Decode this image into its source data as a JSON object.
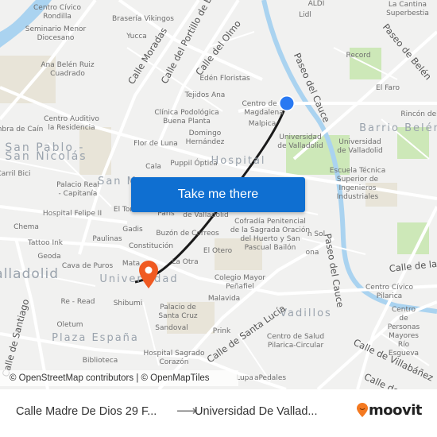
{
  "map": {
    "labels": {
      "centro_civico_rondilla": "Centro Cívico\nRondilla",
      "braseria": "Brasería Vikingos",
      "seminario": "Seminario Menor\nDiocesano",
      "yucca": "Yucca",
      "ana_belen": "Ana Belén Ruiz\nCuadrado",
      "aldi": "ALDI",
      "lidl": "Lidl",
      "la_cantina": "La Cantina\nSuperbestia",
      "record": "Record",
      "el_faro": "El Faro",
      "eden": "Edén Floristas",
      "tejidos": "Tejidos Ana",
      "centro_magdalena": "Centro de la\nMagdalena",
      "clinica": "Clínica Podológica\nBuena Planta",
      "domingo": "Domingo\nHernández",
      "malpica": "Malpica",
      "uva1": "Universidad\nde Valladolid",
      "uva2": "Universidad\nde Valladolid",
      "rincon": "Rincón del",
      "centro_auditivo": "Centro Auditivo\nla Residencia",
      "sombra_cain": "mbra de Caín",
      "flor_luna": "Flor de Luna",
      "cala": "Cala",
      "puppil": "Puppil Óptica",
      "carril_bici": "Carril Bici",
      "escuela": "Escuela Técnica\nSuperior de Ingenieros\nIndustriales",
      "palacio_real": "Palacio Real\n- Capitanía",
      "hospital_felipe": "Hospital Felipe II",
      "el_tor": "El Tor",
      "paris": "Paris",
      "de_valladolid": "de Valladolid",
      "chema": "Chema",
      "gadis": "Gadis",
      "buzon": "Buzón de Correos",
      "cofradia": "Cofradía Penitencial\nde la Sagrada Oración\ndel Huerto y San\nPascual Bailón",
      "n_sol": "n Sol",
      "ona": "ona",
      "tattoo": "Tattoo Ink",
      "paulinas": "Paulinas",
      "constitucion": "Constitución",
      "geoda": "Geoda",
      "el_otero": "El Otero",
      "cava": "Cava de Puros",
      "mata": "Mata",
      "la_otra": "La Otra",
      "colegio": "Colegio Mayor\nPeñafiel",
      "centro_pilarica": "Centro Cívico\nPilarica",
      "re_read": "Re - Read",
      "shibumi": "Shibumi",
      "palacio_sc": "Palacio de\nSanta Cruz",
      "malavida": "Malavida",
      "centro_personas": "Centro de\nPersonas Mayores\nRío Esgueva",
      "oletum": "Oletum",
      "sandoval": "Sandoval",
      "prink": "Prink",
      "centro_salud": "Centro de Salud\nPilarica-Circular",
      "hospital_sagrado": "Hospital Sagrado\nCorazón",
      "biblioteca": "Biblioteca",
      "lupa": "Lupa",
      "apedales": "aPedales"
    },
    "districts": {
      "san_pablo": "San Pablo -\nSan Nicolás",
      "barrio_belen": "Barrio Belén",
      "hospital": "Hospital",
      "san_m": "San M",
      "valladolid": "Valladolid",
      "universidad": "Universidad",
      "plaza_espana": "Plaza España",
      "vadillos": "Vadillos"
    },
    "streets": {
      "moradas": "Calle Moradas",
      "portillo": "Calle del Portillo de B",
      "olmo": "Calle del Olmo",
      "cauce_top": "Paseo del Cauce",
      "belen": "Paseo de Belén",
      "cauce_bottom": "Paseo del Cauce",
      "calle_de_la": "Calle de la",
      "villabanez": "Calle de Villabáñez",
      "santa_lucia": "Calle de Santa Lucía",
      "santiago": "Calle de Santiago",
      "calle_de_bottom": "Calle de"
    },
    "colors": {
      "background": "#f1f1f0",
      "water": "#aad3f0",
      "park": "#cde8b8",
      "route": "#1a1a1a",
      "origin": "#2979f2",
      "destination": "#f05a22"
    }
  },
  "cta": {
    "label": "Take me there"
  },
  "attribution": "© OpenStreetMap contributors | © OpenMapTiles",
  "footer": {
    "from": "Calle Madre De Dios 29 F...",
    "arrow": "⟶",
    "to": "Universidad De Vallad...",
    "brand": "moovit",
    "brand_color": "#f47920"
  }
}
